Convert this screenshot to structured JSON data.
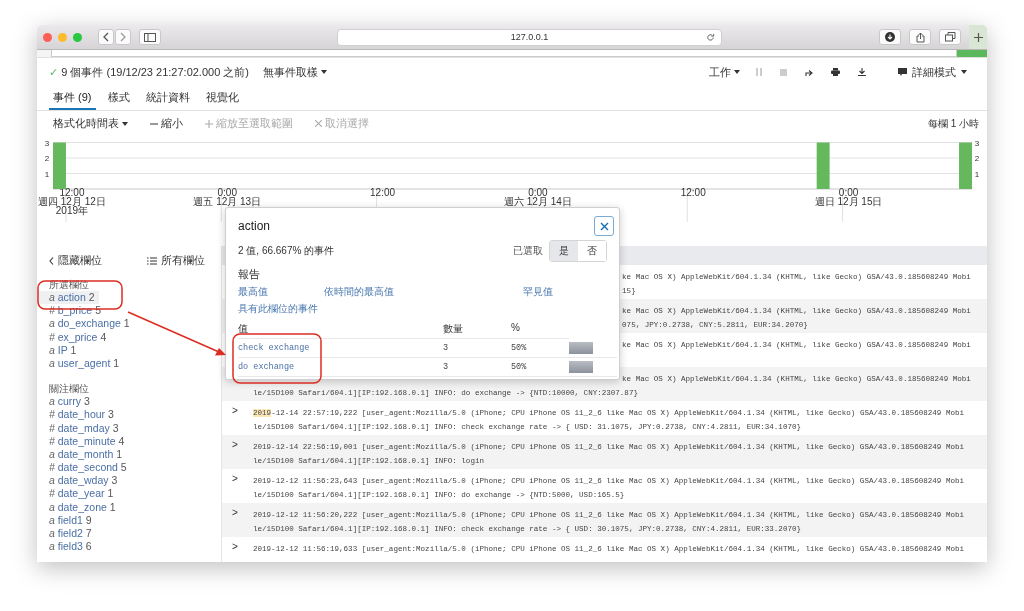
{
  "browser": {
    "address": "127.0.0.1"
  },
  "summary": {
    "check": "✓",
    "text": "9 個事件 (19/12/23 21:27:02.000 之前)",
    "sampling": "無事件取樣",
    "job": "工作",
    "mode": "詳細模式"
  },
  "tabs": [
    {
      "label": "事件 (9)",
      "selected": true
    },
    {
      "label": "樣式",
      "selected": false
    },
    {
      "label": "統計資料",
      "selected": false
    },
    {
      "label": "視覺化",
      "selected": false
    }
  ],
  "timeline_tools": [
    {
      "kind": "menu",
      "label": "格式化時間表",
      "disabled": false
    },
    {
      "kind": "zoom-out",
      "label": "縮小",
      "disabled": false
    },
    {
      "kind": "zoom-in",
      "label": "縮放至選取範圍",
      "disabled": true
    },
    {
      "kind": "deselect",
      "label": "取消選擇",
      "disabled": true
    }
  ],
  "bucket_label": "每欄 1 小時",
  "timeline": {
    "left_axis_labels": [
      "3",
      "2",
      "1"
    ],
    "right_axis_labels": [
      "3",
      "2",
      "1"
    ],
    "chart_data": {
      "type": "bar",
      "ylim": [
        0,
        3
      ],
      "yticks": [
        1,
        2,
        3
      ],
      "categories": [
        null,
        "12:00\n週四 12月 12日\n2019年",
        null,
        null,
        null,
        null,
        null,
        null,
        null,
        null,
        null,
        null,
        null,
        "0:00\n週五 12月 13日",
        null,
        null,
        null,
        null,
        null,
        null,
        null,
        null,
        null,
        null,
        null,
        "12:00",
        null,
        null,
        null,
        null,
        null,
        null,
        null,
        null,
        null,
        null,
        null,
        "0:00\n週六 12月 14日",
        null,
        null,
        null,
        null,
        null,
        null,
        null,
        null,
        null,
        null,
        null,
        "12:00",
        null,
        null,
        null,
        null,
        null,
        null,
        null,
        null,
        null,
        null,
        null,
        "0:00\n週日 12月 15日",
        null,
        null,
        null,
        null,
        null,
        null,
        null,
        null,
        null
      ],
      "values": [
        3,
        null,
        null,
        null,
        null,
        null,
        null,
        null,
        null,
        null,
        null,
        null,
        null,
        null,
        null,
        null,
        null,
        null,
        null,
        null,
        null,
        null,
        null,
        null,
        null,
        null,
        null,
        null,
        null,
        null,
        null,
        null,
        null,
        null,
        null,
        null,
        null,
        null,
        null,
        null,
        null,
        null,
        null,
        null,
        null,
        null,
        null,
        null,
        null,
        null,
        null,
        null,
        null,
        null,
        null,
        null,
        null,
        null,
        null,
        3,
        null,
        null,
        null,
        null,
        null,
        null,
        null,
        null,
        null,
        null,
        3
      ]
    }
  },
  "sidebar": {
    "hide_label": "隱藏欄位",
    "all_label": "所有欄位",
    "sections": [
      {
        "title": "所選欄位",
        "fields": [
          {
            "type": "a",
            "name": "action",
            "count": "2",
            "selected": true
          },
          {
            "type": "#",
            "name": "b_price",
            "count": "5",
            "selected": false
          },
          {
            "type": "a",
            "name": "do_exchange",
            "count": "1",
            "selected": false
          },
          {
            "type": "#",
            "name": "ex_price",
            "count": "4",
            "selected": false
          },
          {
            "type": "a",
            "name": "IP",
            "count": "1",
            "selected": false
          },
          {
            "type": "a",
            "name": "user_agent",
            "count": "1",
            "selected": false
          }
        ]
      },
      {
        "title": "關注欄位",
        "fields": [
          {
            "type": "a",
            "name": "curry",
            "count": "3",
            "selected": false
          },
          {
            "type": "#",
            "name": "date_hour",
            "count": "3",
            "selected": false
          },
          {
            "type": "#",
            "name": "date_mday",
            "count": "3",
            "selected": false
          },
          {
            "type": "#",
            "name": "date_minute",
            "count": "4",
            "selected": false
          },
          {
            "type": "a",
            "name": "date_month",
            "count": "1",
            "selected": false
          },
          {
            "type": "#",
            "name": "date_second",
            "count": "5",
            "selected": false
          },
          {
            "type": "a",
            "name": "date_wday",
            "count": "3",
            "selected": false
          },
          {
            "type": "#",
            "name": "date_year",
            "count": "1",
            "selected": false
          },
          {
            "type": "a",
            "name": "date_zone",
            "count": "1",
            "selected": false
          },
          {
            "type": "a",
            "name": "field1",
            "count": "9",
            "selected": false
          },
          {
            "type": "a",
            "name": "field2",
            "count": "7",
            "selected": false
          },
          {
            "type": "a",
            "name": "field3",
            "count": "6",
            "selected": false
          }
        ]
      }
    ]
  },
  "events": [
    {
      "lines": [
        {
          "text": "ke Mac OS X) AppleWebKit/604.1.34 (KHTML, like Gecko) GSA/43.0.185608249 Mobi",
          "covered": true
        },
        {
          "text": "15}",
          "covered": true
        }
      ]
    },
    {
      "lines": [
        {
          "text": "ke Mac OS X) AppleWebKit/604.1.34 (KHTML, like Gecko) GSA/43.0.185608249 Mobi",
          "covered": true
        },
        {
          "text": "075, JPY:0.2738, CNY:5.2811, EUR:34.2070}",
          "covered": true
        }
      ]
    },
    {
      "lines": [
        {
          "text": "ke Mac OS X) AppleWebKit/604.1.34 (KHTML, like Gecko) GSA/43.0.185608249 Mobi",
          "covered": true
        }
      ]
    },
    {
      "lines": [
        {
          "text": "ke Mac OS X) AppleWebKit/604.1.34 (KHTML, like Gecko) GSA/43.0.185608249 Mobi",
          "covered": true
        },
        {
          "text": "le/15D100 Safari/604.1][IP:192.168.0.1] INFO: do exchange -> {NTD:10000, CNY:2307.87}",
          "covered": false
        }
      ]
    },
    {
      "toggle": ">",
      "lines": [
        {
          "highlight": "2019",
          "text": "-12-14 22:57:19,222 [user_agent:Mozilla/5.0 (iPhone; CPU iPhone OS 11_2_6 like Mac OS X) AppleWebKit/604.1.34 (KHTML, like Gecko) GSA/43.0.185608249 Mobi",
          "covered": false
        },
        {
          "text": "le/15D100 Safari/604.1][IP:192.168.0.1] INFO: check exchange rate -> { USD: 31.1075, JPY:0.2738, CNY:4.2811, EUR:34.1070}",
          "covered": false
        }
      ]
    },
    {
      "toggle": ">",
      "lines": [
        {
          "text": "2019-12-14 22:56:19,001 [user_agent:Mozilla/5.0 (iPhone; CPU iPhone OS 11_2_6 like Mac OS X) AppleWebKit/604.1.34 (KHTML, like Gecko) GSA/43.0.185608249 Mobi",
          "covered": false
        },
        {
          "text": "le/15D100 Safari/604.1][IP:192.168.0.1] INFO: login",
          "covered": false
        }
      ]
    },
    {
      "toggle": ">",
      "lines": [
        {
          "text": "2019-12-12 11:56:23,643 [user_agent:Mozilla/5.0 (iPhone; CPU iPhone OS 11_2_6 like Mac OS X) AppleWebKit/604.1.34 (KHTML, like Gecko) GSA/43.0.185608249 Mobi",
          "covered": false
        },
        {
          "text": "le/15D100 Safari/604.1][IP:192.168.0.1] INFO: do exchange -> {NTD:5000, USD:165.5}",
          "covered": false
        }
      ]
    },
    {
      "toggle": ">",
      "lines": [
        {
          "text": "2019-12-12 11:56:20,222 [user_agent:Mozilla/5.0 (iPhone; CPU iPhone OS 11_2_6 like Mac OS X) AppleWebKit/604.1.34 (KHTML, like Gecko) GSA/43.0.185608249 Mobi",
          "covered": false
        },
        {
          "text": "le/15D100 Safari/604.1][IP:192.168.0.1] INFO: check exchange rate -> { USD: 30.1075, JPY:0.2738, CNY:4.2811, EUR:33.2070}",
          "covered": false
        }
      ]
    },
    {
      "toggle": ">",
      "lines": [
        {
          "text": "2019-12-12 11:56:19,633 [user_agent:Mozilla/5.0 (iPhone; CPU iPhone OS 11_2_6 like Mac OS X) AppleWebKit/604.1.34 (KHTML, like Gecko) GSA/43.0.185608249 Mobi",
          "covered": false
        }
      ]
    }
  ],
  "popup": {
    "title": "action",
    "stats": "2 值, 66.667% 的事件",
    "selected_label": "已選取",
    "toggle": [
      {
        "label": "是",
        "selected": true
      },
      {
        "label": "否",
        "selected": false
      }
    ],
    "reports_title": "報告",
    "reports": [
      "最高值",
      "依時間的最高值",
      "罕見值",
      "具有此欄位的事件"
    ],
    "columns": [
      "值",
      "數量",
      "%"
    ],
    "values": [
      {
        "value": "check exchange",
        "count": "3",
        "percent": "50%",
        "level": 0.5
      },
      {
        "value": "do exchange",
        "count": "3",
        "percent": "50%",
        "level": 0.5
      }
    ]
  }
}
